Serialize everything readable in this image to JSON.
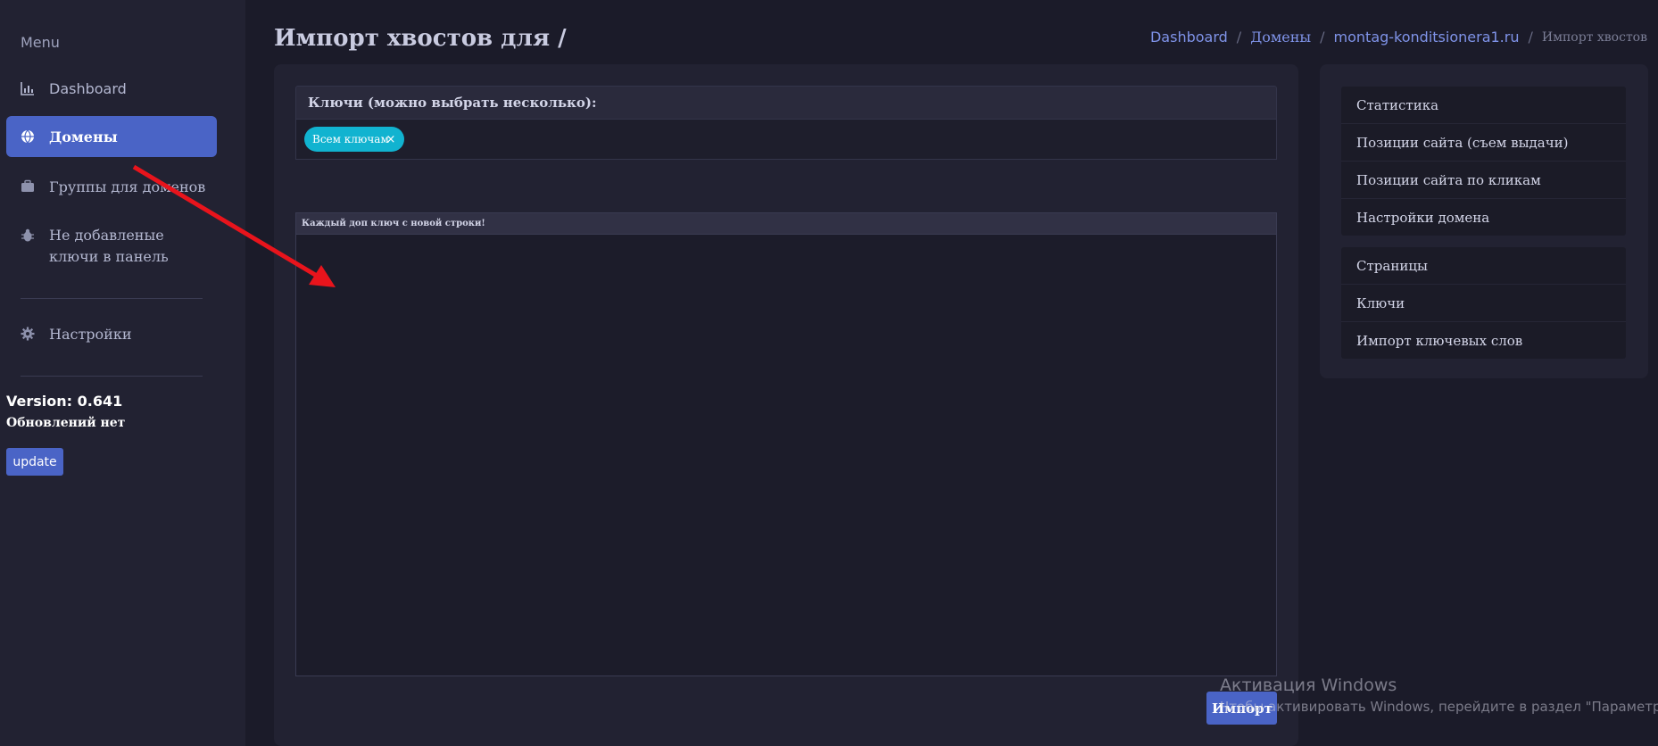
{
  "sidebar": {
    "menu_title": "Menu",
    "items": [
      {
        "label": "Dashboard",
        "icon": "bar-chart-icon"
      },
      {
        "label": "Домены",
        "icon": "globe-icon",
        "active": true
      },
      {
        "label": "Группы для доменов",
        "icon": "briefcase-icon"
      },
      {
        "label": "Не добавленые ключи в панель",
        "icon": "bug-icon"
      },
      {
        "label": "Настройки",
        "icon": "gear-icon"
      }
    ],
    "version": "Version: 0.641",
    "updates_status": "Обновлений нет",
    "update_button": "update"
  },
  "header": {
    "title": "Импорт хвостов для /",
    "breadcrumb": [
      "Dashboard",
      "Домены",
      "montag-konditsionera1.ru",
      "Импорт хвостов"
    ],
    "breadcrumb_sep": "/"
  },
  "form": {
    "keys_label": "Ключи (можно выбрать несколько):",
    "selected_chip": "Всем ключам",
    "chip_remove": "×",
    "textarea_label": "Каждый доп ключ с новой строки!",
    "textarea_value": "",
    "import_button": "Импорт"
  },
  "right_panel": {
    "group1": [
      "Статистика",
      "Позиции сайта (съем выдачи)",
      "Позиции сайта по кликам",
      "Настройки домена"
    ],
    "group2": [
      "Страницы",
      "Ключи",
      "Импорт ключевых слов"
    ]
  },
  "watermark": {
    "line1": "Активация Windows",
    "line2": "Чтобы активировать Windows, перейдите в раздел \"Параметры\"."
  },
  "colors": {
    "accent": "#4a64c6",
    "chip": "#11b3d0",
    "annotation_arrow": "#e8141c"
  }
}
